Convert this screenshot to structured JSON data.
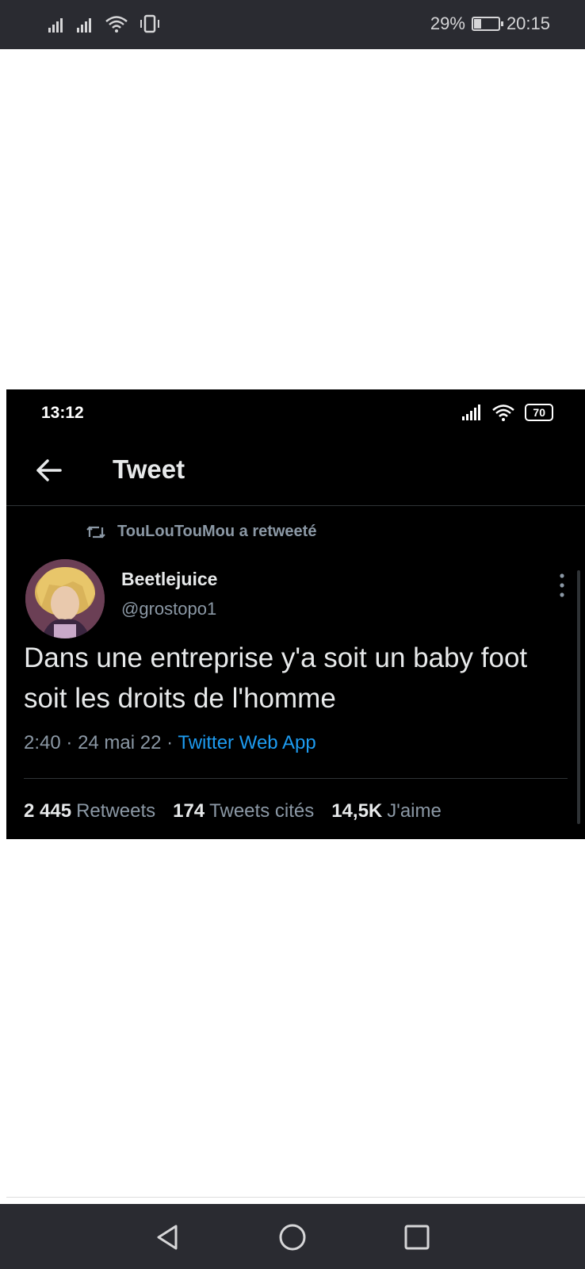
{
  "outer_status": {
    "battery": "29%",
    "time": "20:15"
  },
  "inner_status": {
    "time": "13:12",
    "battery": "70"
  },
  "header": {
    "title": "Tweet"
  },
  "tweet": {
    "retweeted_by": "TouLouTouMou a retweeté",
    "author_name": "Beetlejuice",
    "author_handle": "@grostopo1",
    "text": "Dans une entreprise y'a soit un baby foot soit les droits de l'homme",
    "time": "2:40",
    "date": "24 mai 22",
    "source": "Twitter Web App",
    "stats": {
      "retweets_count": "2 445",
      "retweets_label": "Retweets",
      "quotes_count": "174",
      "quotes_label": "Tweets cités",
      "likes_count": "14,5K",
      "likes_label": "J'aime"
    }
  },
  "colors": {
    "link": "#1d9bf0",
    "muted": "#8b98a5",
    "text": "#e7e9ea"
  }
}
